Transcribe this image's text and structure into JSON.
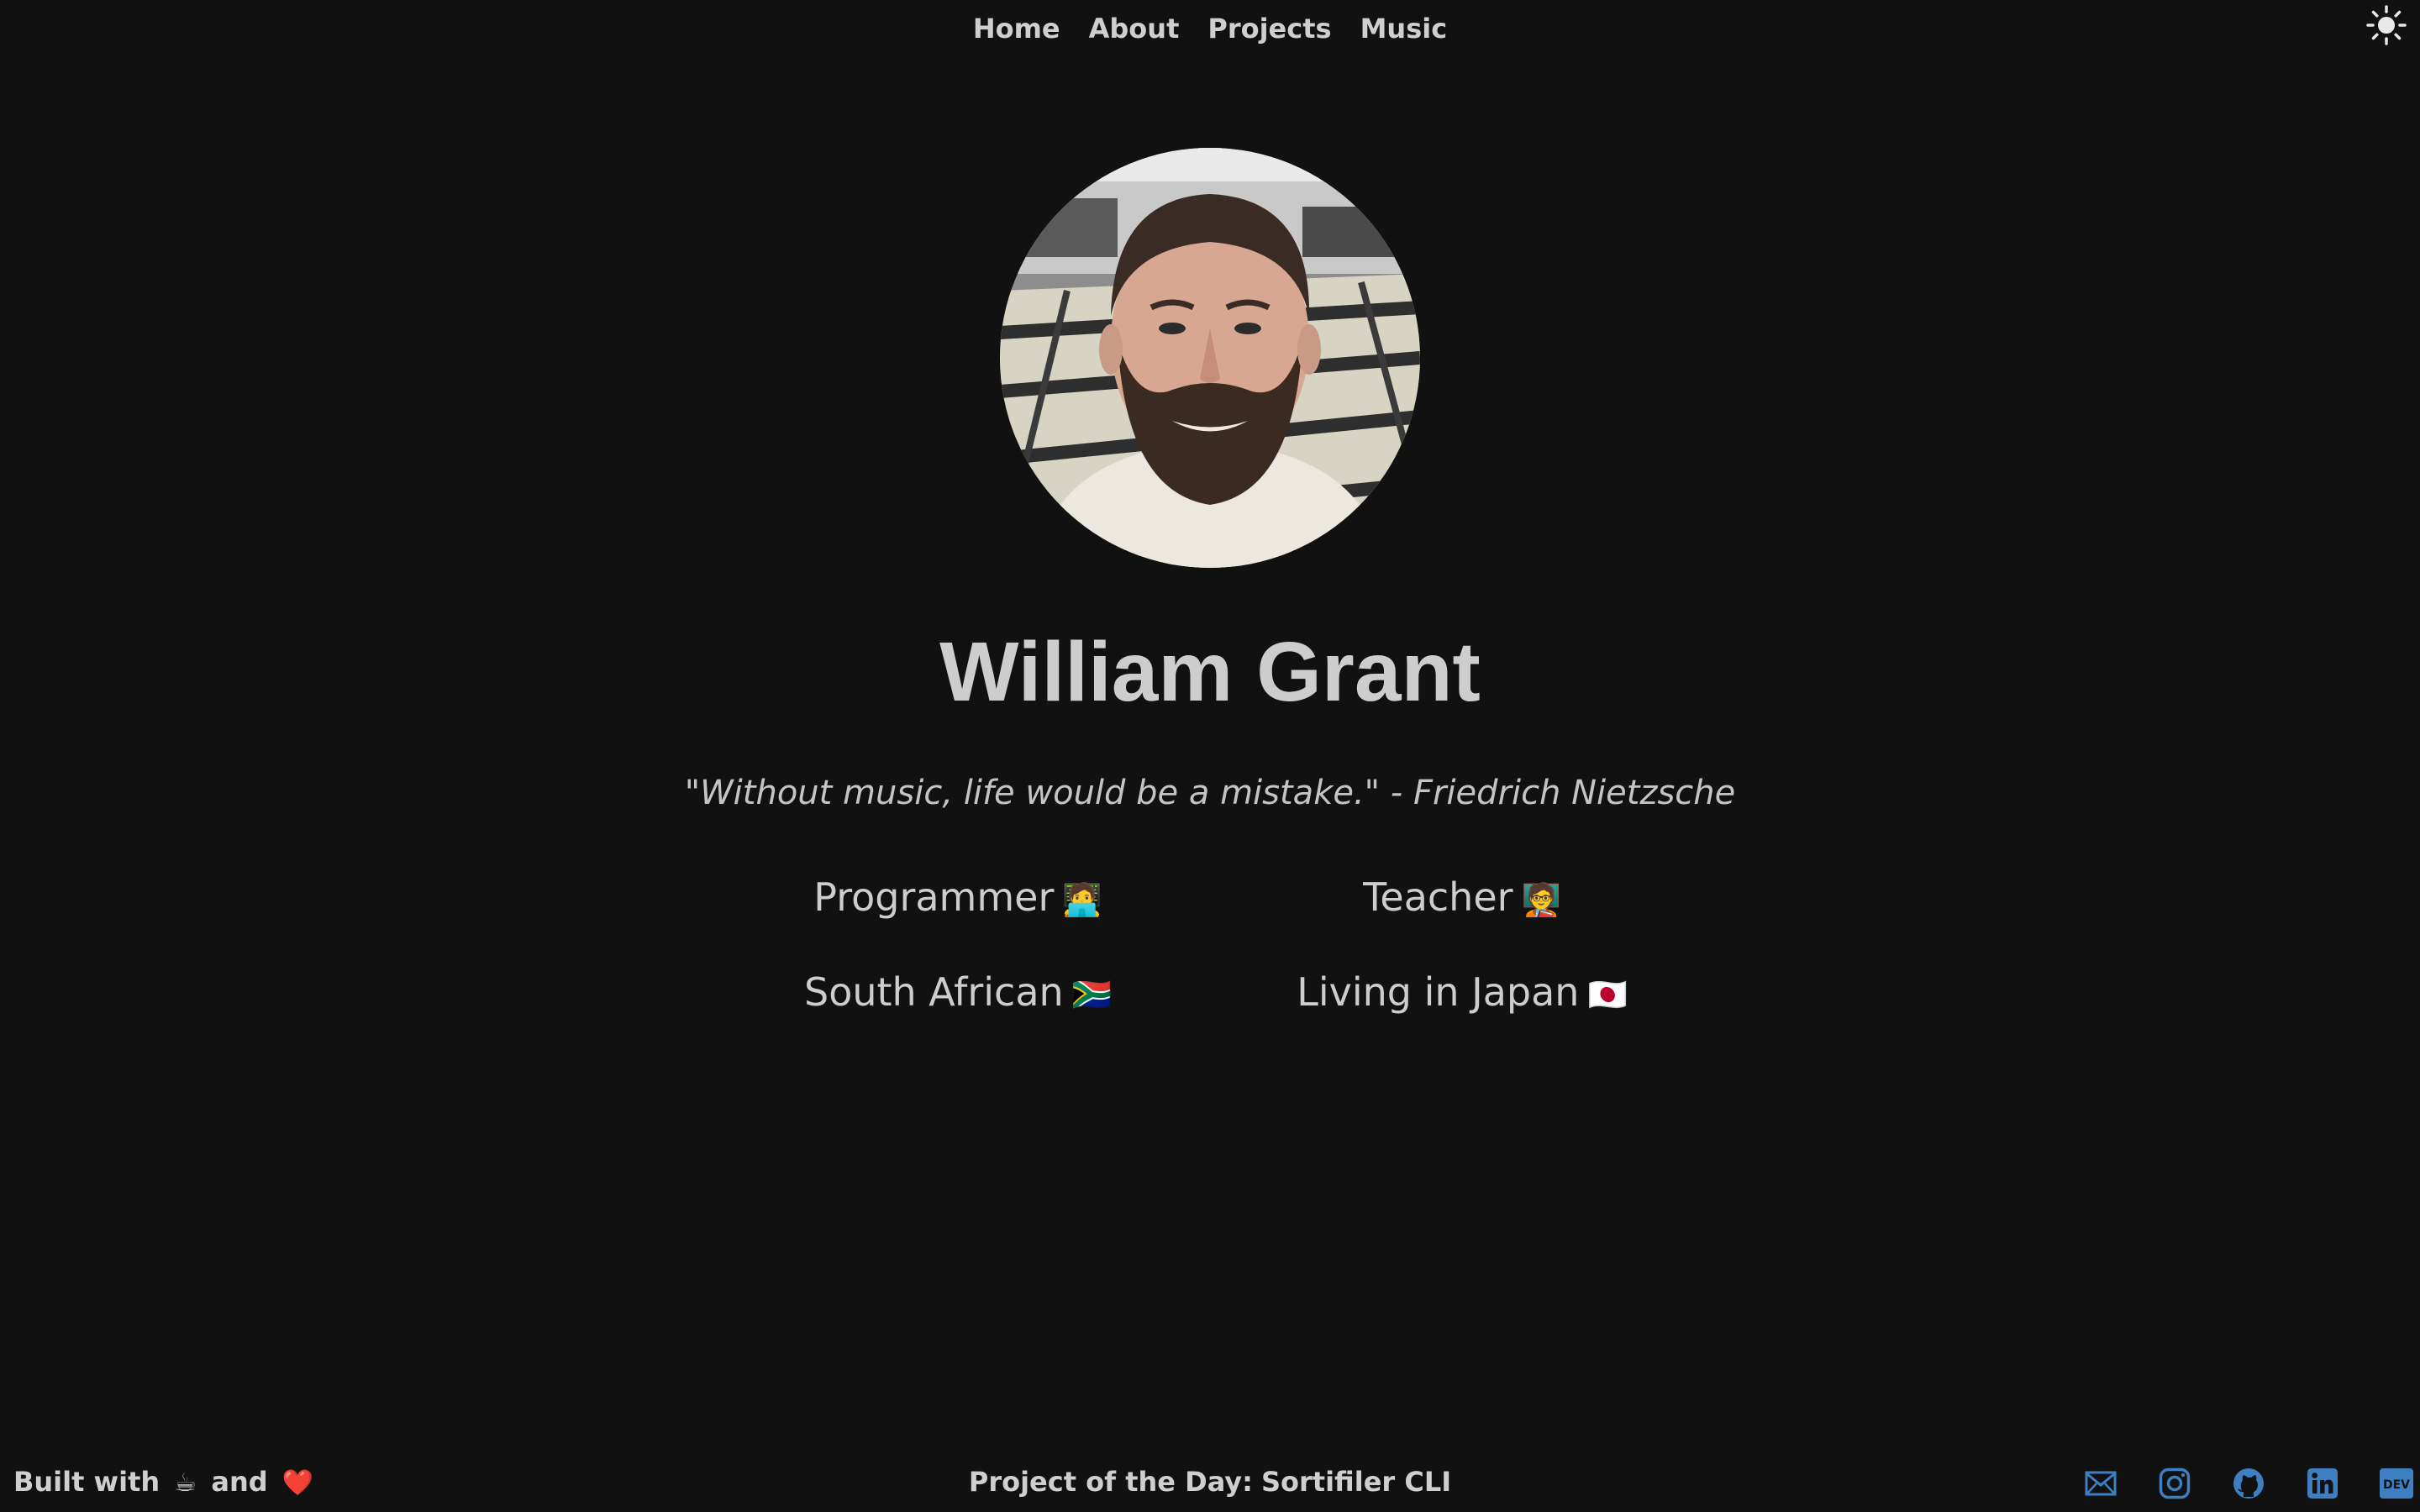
{
  "nav": {
    "items": [
      {
        "label": "Home"
      },
      {
        "label": "About"
      },
      {
        "label": "Projects"
      },
      {
        "label": "Music"
      }
    ],
    "theme_toggle_icon": "sun-icon"
  },
  "profile": {
    "name": "William Grant",
    "quote": "\"Without music, life would be a mistake.\" - Friedrich Nietzsche",
    "avatar_icon": "profile-photo"
  },
  "facts": [
    {
      "label": "Programmer",
      "emoji": "🧑‍💻"
    },
    {
      "label": "Teacher",
      "emoji": "🧑‍🏫"
    },
    {
      "label": "South African",
      "emoji": "🇿🇦"
    },
    {
      "label": "Living in Japan",
      "emoji": "🇯🇵"
    }
  ],
  "footer": {
    "built_prefix": "Built with",
    "built_emoji_1": "☕",
    "built_and": "and",
    "built_emoji_2": "❤️",
    "project_label": "Project of the Day:",
    "project_name": "Sortifiler CLI",
    "socials": [
      {
        "icon": "mail-icon"
      },
      {
        "icon": "instagram-icon"
      },
      {
        "icon": "github-icon"
      },
      {
        "icon": "linkedin-icon"
      },
      {
        "icon": "dev-icon",
        "text": "DEV"
      }
    ],
    "social_color": "#3d7fc1"
  },
  "colors": {
    "background": "#111111",
    "text": "#cdcdcd"
  }
}
